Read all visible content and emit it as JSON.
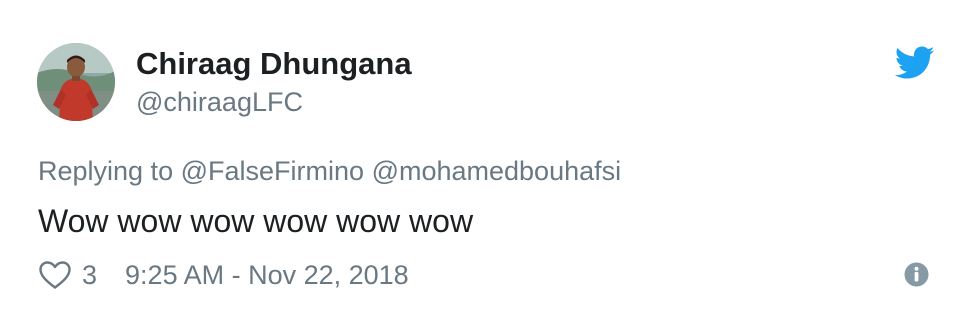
{
  "tweet": {
    "author": {
      "name": "Chiraag Dhungana",
      "handle": "@chiraagLFC"
    },
    "reply": {
      "prefix": "Replying to",
      "mentions": [
        "@FalseFirmino",
        "@mohamedbouhafsi"
      ]
    },
    "text": "Wow wow wow wow wow wow",
    "likes": "3",
    "timestamp": "9:25 AM - Nov 22, 2018"
  },
  "icons": {
    "brand": "twitter-bird-icon",
    "like": "heart-outline-icon",
    "info": "info-circle-icon"
  },
  "colors": {
    "twitter_blue": "#1da1f2",
    "text_primary": "#1c2022",
    "text_secondary": "#697882",
    "info_icon": "#8899a6"
  }
}
